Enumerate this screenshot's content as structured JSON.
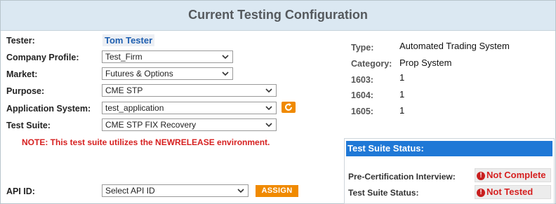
{
  "header": {
    "title": "Current Testing Configuration"
  },
  "form": {
    "tester_label": "Tester:",
    "tester_name": "Tom Tester",
    "company_label": "Company Profile:",
    "company_value": "Test_Firm",
    "market_label": "Market:",
    "market_value": "Futures & Options",
    "purpose_label": "Purpose:",
    "purpose_value": "CME STP",
    "application_label": "Application System:",
    "application_value": "test_application",
    "suite_label": "Test Suite:",
    "suite_value": "CME STP FIX Recovery",
    "note": "NOTE: This test suite utilizes the NEWRELEASE environment.",
    "api_label": "API ID:",
    "api_value": "Select API ID",
    "assign_label": "ASSIGN"
  },
  "details": {
    "type_label": "Type:",
    "type_value": "Automated Trading System",
    "category_label": "Category:",
    "category_value": "Prop System",
    "f1603_label": "1603:",
    "f1603_value": "1",
    "f1604_label": "1604:",
    "f1604_value": "1",
    "f1605_label": "1605:",
    "f1605_value": "1"
  },
  "status": {
    "title": "Test Suite Status:",
    "interview_label": "Pre-Certification Interview:",
    "interview_value": "Not Complete",
    "suite_status_label": "Test Suite Status:",
    "suite_status_value": "Not Tested",
    "alert_glyph": "!"
  },
  "colors": {
    "header_bg": "#dbe8f2",
    "accent_orange": "#f08a00",
    "status_blue": "#1f78d6",
    "alert_red": "#d62020"
  }
}
